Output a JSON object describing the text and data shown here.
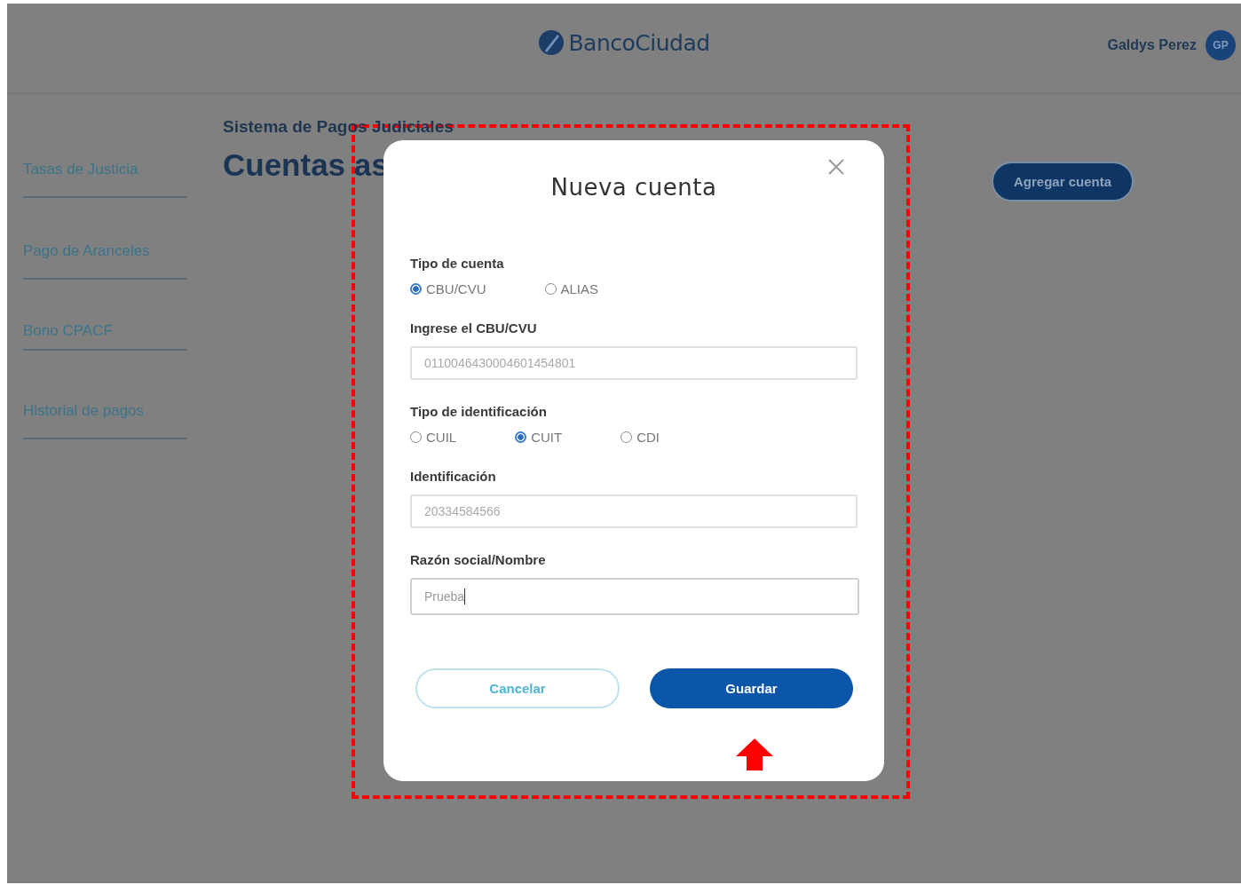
{
  "header": {
    "logo": "BancoCiudad",
    "user": {
      "name": "Galdys Perez",
      "initials": "GP"
    }
  },
  "sidebar": {
    "items": [
      {
        "label": "Tasas de Justicia"
      },
      {
        "label": "Pago de Aranceles"
      },
      {
        "label": "Bono CPACF"
      },
      {
        "label": "Historial de pagos"
      }
    ]
  },
  "page": {
    "breadcrumb": "Sistema de Pagos Judiciales",
    "title": "Cuentas as",
    "action": "Agregar cuenta"
  },
  "dialog": {
    "title": "Nueva cuenta",
    "fields": [
      {
        "kind": "radio",
        "label": "Tipo de cuenta",
        "options": [
          {
            "label": "CBU/CVU",
            "selected": true
          },
          {
            "label": "ALIAS",
            "selected": false
          }
        ]
      },
      {
        "kind": "text",
        "label": "Ingrese el CBU/CVU",
        "value": "0110046430004601454801",
        "focused": false
      },
      {
        "kind": "radio",
        "label": "Tipo de identificación",
        "options": [
          {
            "label": "CUIL",
            "selected": false
          },
          {
            "label": "CUIT",
            "selected": true
          },
          {
            "label": "CDI",
            "selected": false
          }
        ]
      },
      {
        "kind": "text",
        "label": "Identificación",
        "value": "20334584566",
        "focused": false
      },
      {
        "kind": "text",
        "label": "Razón social/Nombre",
        "value": "Prueba",
        "focused": true
      }
    ],
    "buttons": [
      {
        "kind": "secondary",
        "label": "Cancelar"
      },
      {
        "kind": "primary",
        "label": "Guardar"
      }
    ]
  }
}
